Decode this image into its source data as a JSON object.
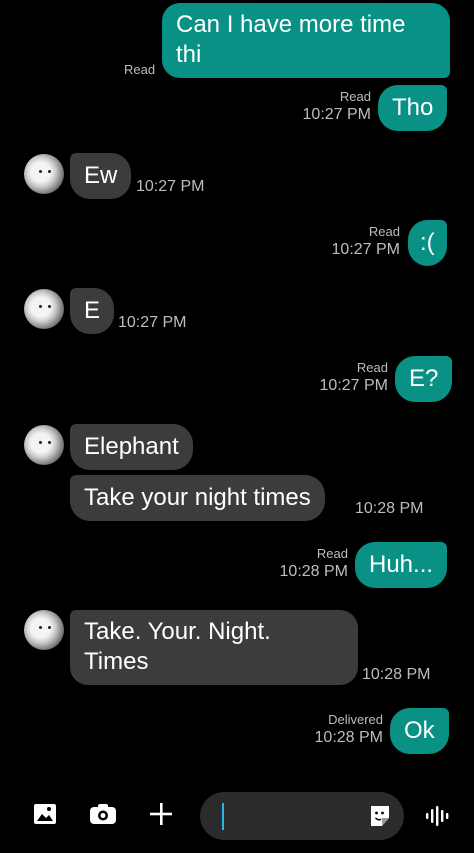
{
  "messages": [
    {
      "id": 1,
      "direction": "outgoing",
      "lines": [
        "Can I have more time",
        "thi"
      ],
      "status": "Read"
    },
    {
      "id": 2,
      "direction": "outgoing",
      "text": "Tho",
      "status": "Read",
      "time": "10:27 PM"
    },
    {
      "id": 3,
      "direction": "incoming",
      "text": "Ew",
      "time": "10:27 PM"
    },
    {
      "id": 4,
      "direction": "outgoing",
      "text": ":(",
      "status": "Read",
      "time": "10:27 PM"
    },
    {
      "id": 5,
      "direction": "incoming",
      "text": "E",
      "time": "10:27 PM"
    },
    {
      "id": 6,
      "direction": "outgoing",
      "text": "E?",
      "status": "Read",
      "time": "10:27 PM"
    },
    {
      "id": 7,
      "direction": "incoming",
      "text": "Elephant"
    },
    {
      "id": 8,
      "direction": "incoming",
      "text": "Take your night times",
      "time": "10:28 PM"
    },
    {
      "id": 9,
      "direction": "outgoing",
      "text": "Huh...",
      "status": "Read",
      "time": "10:28 PM"
    },
    {
      "id": 10,
      "direction": "incoming",
      "lines": [
        "Take. Your. Night.",
        "Times"
      ],
      "time": "10:28 PM"
    },
    {
      "id": 11,
      "direction": "outgoing",
      "text": "Ok",
      "status": "Delivered",
      "time": "10:28 PM"
    }
  ],
  "composer": {
    "placeholder": "",
    "value": "",
    "icons": [
      "gallery-icon",
      "camera-icon",
      "plus-icon",
      "sticker-icon",
      "voice-icon"
    ]
  },
  "colors": {
    "background": "#000000",
    "outgoing_bubble": "#0a9186",
    "incoming_bubble": "#3c3c3e",
    "meta_text": "#bdbdbd",
    "caret": "#2bb3e6"
  }
}
